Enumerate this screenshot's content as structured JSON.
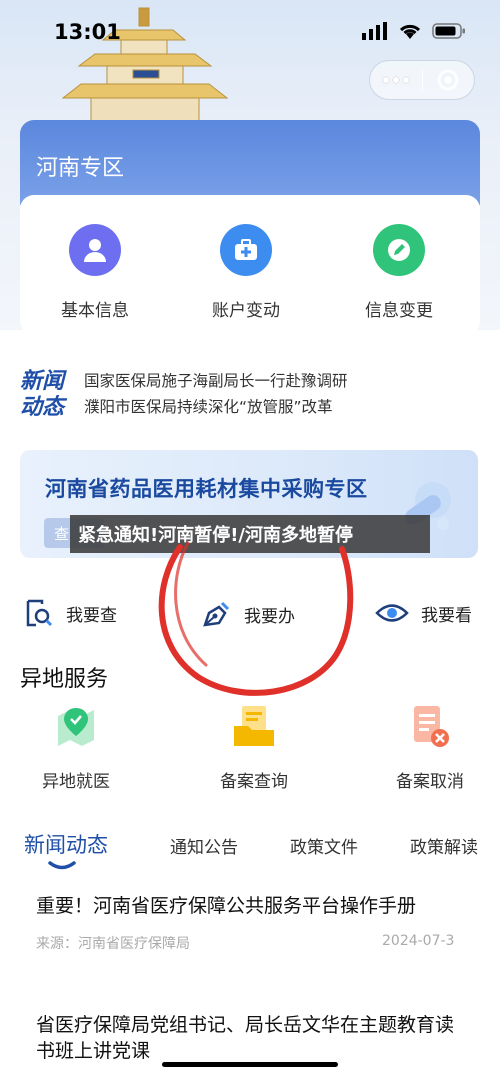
{
  "status_bar": {
    "time": "13:01"
  },
  "henan": {
    "title": "河南专区",
    "quick_actions": [
      {
        "label": "基本信息",
        "icon": "user-icon",
        "color": "#6d6ff0"
      },
      {
        "label": "账户变动",
        "icon": "medical-kit-icon",
        "color": "#3d8cf0"
      },
      {
        "label": "信息变更",
        "icon": "edit-icon",
        "color": "#2fc47a"
      }
    ]
  },
  "news": {
    "logo_text": [
      "新闻",
      "动态"
    ],
    "items": [
      "国家医保局施子海副局长一行赴豫调研",
      "濮阳市医保局持续深化“放管服”改革"
    ]
  },
  "banner": {
    "title": "河南省药品医用耗材集中采购专区",
    "button": "查"
  },
  "overlay_caption": "紧急通知!河南暂停!/河南多地暂停",
  "actions": [
    {
      "label": "我要查",
      "icon": "search-doc-icon"
    },
    {
      "label": "我要办",
      "icon": "pen-icon"
    },
    {
      "label": "我要看",
      "icon": "eye-icon"
    }
  ],
  "remote_services": {
    "title": "异地服务",
    "items": [
      {
        "label": "异地就医",
        "icon": "map-pin-icon",
        "color": "#2fc47a"
      },
      {
        "label": "备案查询",
        "icon": "folder-doc-icon",
        "color": "#f5b800"
      },
      {
        "label": "备案取消",
        "icon": "doc-cancel-icon",
        "color": "#f07050"
      }
    ]
  },
  "tabs": [
    "新闻动态",
    "通知公告",
    "政策文件",
    "政策解读"
  ],
  "articles": [
    {
      "title": "重要！河南省医疗保障公共服务平台操作手册",
      "source": "来源：河南省医疗保障局",
      "date": "2024-07-3"
    },
    {
      "title": "省医疗保障局党组书记、局长岳文华在主题教育读书班上讲党课"
    }
  ],
  "colors": {
    "primary": "#1f4fa8",
    "header_blue": "#5b87dd",
    "ink_red": "#e0302a"
  }
}
